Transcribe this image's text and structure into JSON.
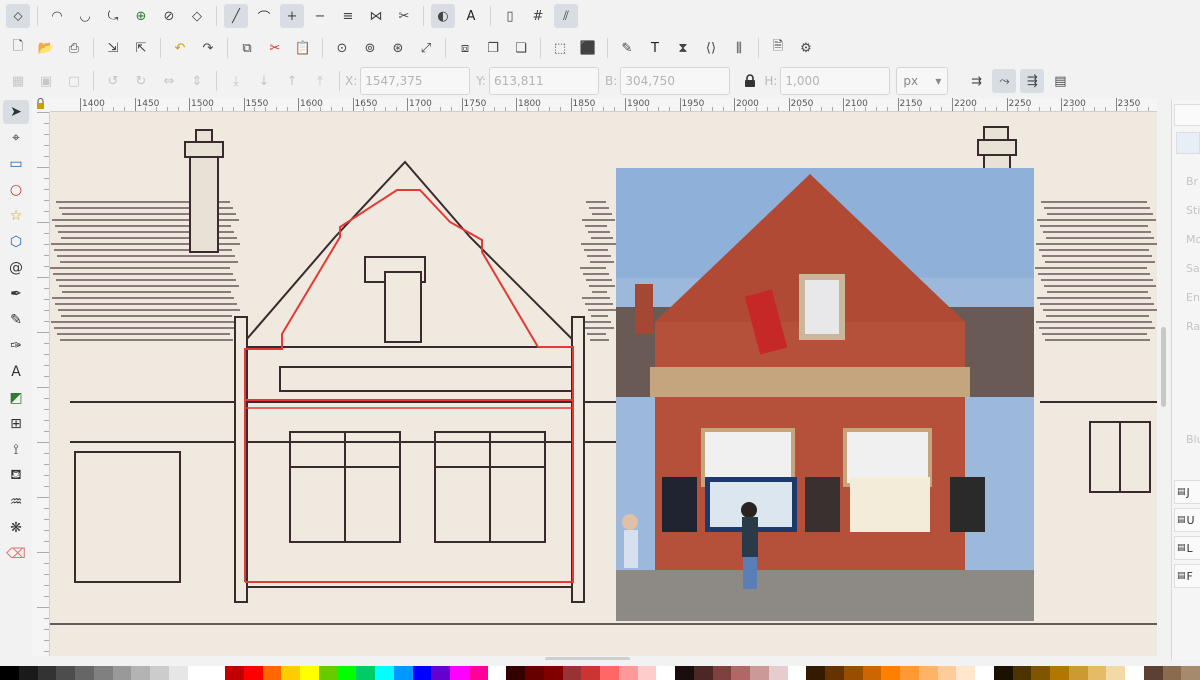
{
  "toolbar_top": {
    "tools": [
      "node-cusp-icon",
      "node-smooth-icon",
      "node-symmetric-icon",
      "node-auto-icon",
      "node-join-icon",
      "node-break-icon",
      "node-type-icon",
      "segment-line-icon",
      "segment-curve-icon",
      "node-insert-icon",
      "node-delete-icon",
      "node-align-icon",
      "show-handles-icon",
      "clip-path-icon",
      "mask-icon",
      "text-icon",
      "page-icon",
      "grid-icon",
      "guides-icon"
    ]
  },
  "toolbar_commands": {
    "tools": [
      "new-doc-icon",
      "open-icon",
      "print-icon",
      "import-icon",
      "export-icon",
      "undo-icon",
      "redo-icon",
      "copy-icon",
      "cut-icon",
      "paste-icon",
      "zoom-selection-icon",
      "zoom-drawing-icon",
      "zoom-page-icon",
      "zoom-fit-icon",
      "duplicate-icon",
      "clone-icon",
      "unlink-clone-icon",
      "group-icon",
      "ungroup-icon",
      "fill-stroke-icon",
      "text-font-icon",
      "layers-icon",
      "xml-editor-icon",
      "align-distribute-icon",
      "document-properties-icon",
      "preferences-icon"
    ]
  },
  "toolbar_select": {
    "x_label": "X:",
    "x_value": "1547,375",
    "y_label": "Y:",
    "y_value": "613,811",
    "w_label": "B:",
    "w_value": "304,750",
    "h_label": "H:",
    "h_value": "1,000",
    "unit": "px"
  },
  "ruler": {
    "labels": [
      "1400",
      "1450",
      "1500",
      "1550",
      "1600",
      "1650",
      "1700",
      "1750",
      "1800",
      "1850",
      "1900",
      "1950",
      "2000",
      "2050",
      "2100",
      "2150",
      "2200",
      "2250",
      "2300",
      "2350"
    ]
  },
  "left_tools": [
    "selector-tool-icon",
    "node-tool-icon",
    "rect-tool-icon",
    "ellipse-tool-icon",
    "star-tool-icon",
    "3d-box-tool-icon",
    "spiral-tool-icon",
    "pen-tool-icon",
    "pencil-tool-icon",
    "calligraphy-tool-icon",
    "text-tool-icon",
    "gradient-tool-icon",
    "mesh-tool-icon",
    "dropper-tool-icon",
    "paint-bucket-tool-icon",
    "tweak-tool-icon",
    "spray-tool-icon",
    "eraser-tool-icon"
  ],
  "dock": {
    "ghost_labels": [
      "Br",
      "Sti",
      "Mo",
      "Sa",
      "En",
      "Ra",
      "Blu"
    ],
    "tabs": [
      "J",
      "U",
      "L",
      "F"
    ]
  },
  "colors": {
    "accent": "#d8dde3",
    "selection_outline": "#e53935",
    "sketch_paper": "#efe9df",
    "sketch_ink": "#3a2a2e"
  },
  "palette": [
    "#000000",
    "#1a1a1a",
    "#333333",
    "#4d4d4d",
    "#666666",
    "#808080",
    "#999999",
    "#b3b3b3",
    "#cccccc",
    "#e6e6e6",
    "#ffffff",
    "#ffffff",
    "#c00000",
    "#ff0000",
    "#ff6600",
    "#ffcc00",
    "#ffff00",
    "#66cc00",
    "#00ff00",
    "#00cc66",
    "#00ffff",
    "#0099ff",
    "#0000ff",
    "#6600cc",
    "#ff00ff",
    "#ff0099",
    "#ffffff",
    "#330000",
    "#660000",
    "#800000",
    "#993333",
    "#cc3333",
    "#ff6666",
    "#ff9999",
    "#ffcccc",
    "#ffffff",
    "#1a0d0d",
    "#4d2626",
    "#804040",
    "#b36666",
    "#cc9999",
    "#e6cccc",
    "#ffffff",
    "#331a00",
    "#663300",
    "#994d00",
    "#cc6600",
    "#ff8000",
    "#ff9933",
    "#ffb366",
    "#ffcc99",
    "#ffe6cc",
    "#ffffff",
    "#1a1100",
    "#4d3300",
    "#805500",
    "#b37700",
    "#cc9933",
    "#e6bb66",
    "#f2d9a6",
    "#ffffff",
    "#5c4033",
    "#8b6b4d",
    "#a68a6d"
  ]
}
